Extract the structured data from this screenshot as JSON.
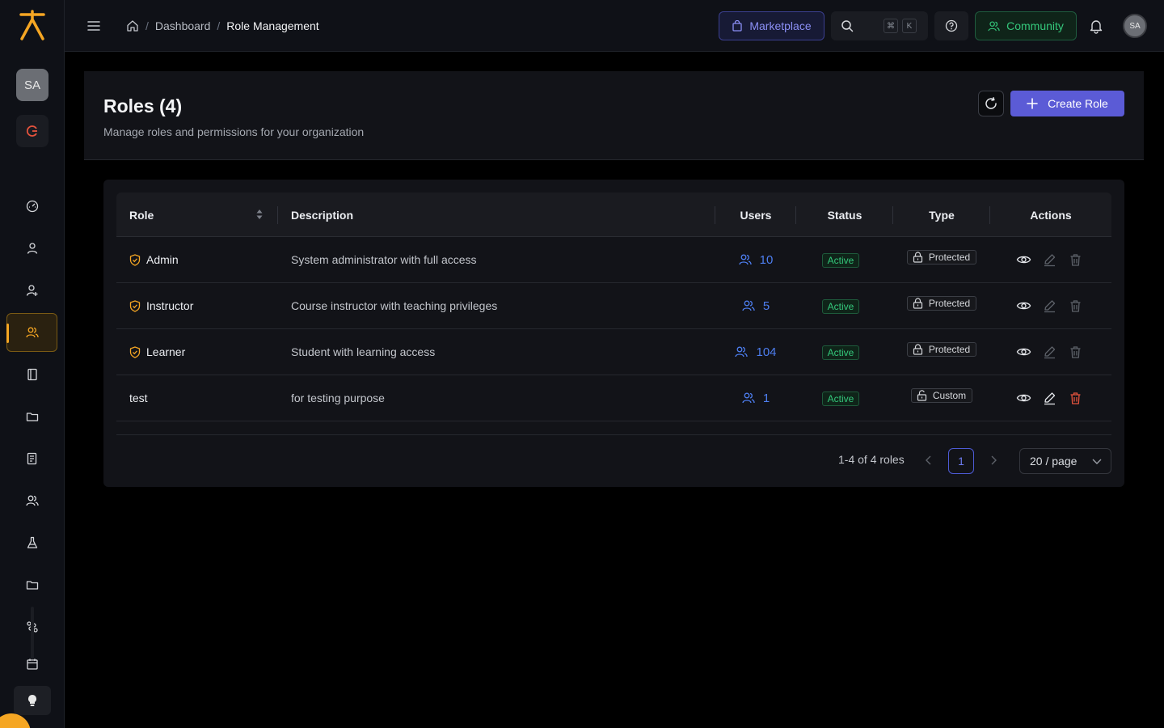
{
  "sidebar": {
    "avatar_initials": "SA",
    "nav_icons": [
      "dashboard-icon",
      "user-icon",
      "user-add-icon",
      "roles-icon",
      "book-icon",
      "folder-icon",
      "report-icon",
      "people-icon",
      "flask-icon",
      "folder-icon",
      "route-icon",
      "calendar-icon"
    ],
    "active_index": 3
  },
  "topbar": {
    "breadcrumb": [
      "Dashboard",
      "Role Management"
    ],
    "marketplace_label": "Marketplace",
    "kbd_cmd": "⌘",
    "kbd_k": "K",
    "community_label": "Community",
    "avatar_initials": "SA"
  },
  "header": {
    "title": "Roles (4)",
    "subtitle": "Manage roles and permissions for your organization",
    "create_label": "Create Role"
  },
  "table": {
    "columns": {
      "role": "Role",
      "description": "Description",
      "users": "Users",
      "status": "Status",
      "type": "Type",
      "actions": "Actions"
    },
    "rows": [
      {
        "name": "Admin",
        "description": "System administrator with full access",
        "users": "10",
        "status": "Active",
        "type": "Protected",
        "shield": true
      },
      {
        "name": "Instructor",
        "description": "Course instructor with teaching privileges",
        "users": "5",
        "status": "Active",
        "type": "Protected",
        "shield": true
      },
      {
        "name": "Learner",
        "description": "Student with learning access",
        "users": "104",
        "status": "Active",
        "type": "Protected",
        "shield": true
      },
      {
        "name": "test",
        "description": "for testing purpose",
        "users": "1",
        "status": "Active",
        "type": "Custom",
        "shield": false
      }
    ]
  },
  "pagination": {
    "summary": "1-4 of 4 roles",
    "current_page": "1",
    "page_size": "20 / page"
  },
  "colors": {
    "accent": "#5b5bd6",
    "brand": "#f5a623",
    "success": "#34c77b",
    "link": "#4d7ef0",
    "danger": "#e5533d"
  }
}
